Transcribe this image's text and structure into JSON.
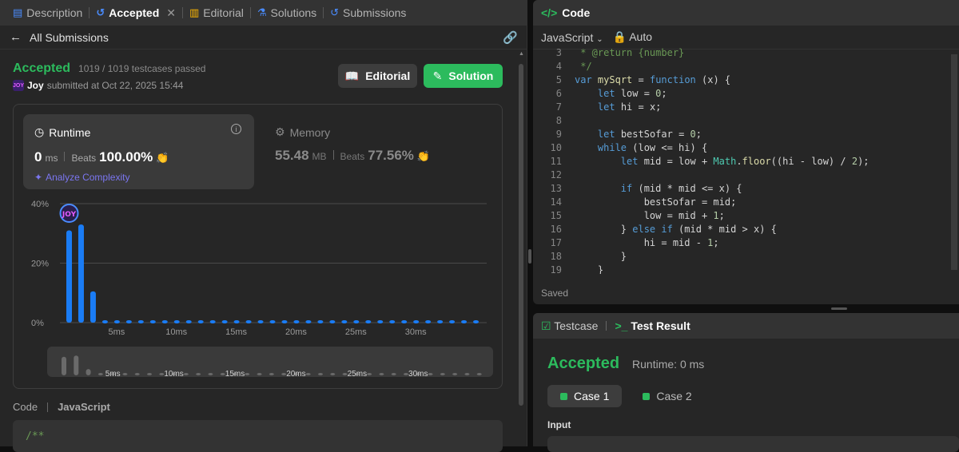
{
  "tabs": [
    {
      "label": "Description",
      "icon": "document-icon"
    },
    {
      "label": "Accepted",
      "icon": "history-icon"
    },
    {
      "label": "Editorial",
      "icon": "book-icon"
    },
    {
      "label": "Solutions",
      "icon": "flask-icon"
    },
    {
      "label": "Submissions",
      "icon": "history-icon"
    }
  ],
  "subheader": {
    "back_label": "All Submissions"
  },
  "result": {
    "status": "Accepted",
    "testcases": "1019 / 1019 testcases passed",
    "user": "Joy",
    "submitted_text": "submitted at Oct 22, 2025 15:44"
  },
  "buttons": {
    "editorial": "Editorial",
    "solution": "Solution"
  },
  "runtime": {
    "title": "Runtime",
    "value": "0",
    "unit": "ms",
    "beats_label": "Beats",
    "beats_value": "100.00%",
    "analyze": "Analyze Complexity"
  },
  "memory": {
    "title": "Memory",
    "value": "55.48",
    "unit": "MB",
    "beats_label": "Beats",
    "beats_value": "77.56%"
  },
  "chart_data": {
    "type": "bar",
    "y_ticks": [
      "40%",
      "20%",
      "0%"
    ],
    "ylim": [
      0,
      40
    ],
    "x_ticks": [
      "5ms",
      "10ms",
      "15ms",
      "20ms",
      "25ms",
      "30ms"
    ],
    "values": [
      31,
      33,
      10.5,
      0.8,
      0.8,
      0.8,
      0.8,
      0.8,
      0.8,
      0.8,
      0.8,
      0.8,
      0.8,
      0.8,
      0.8,
      0.8,
      0.8,
      0.8,
      0.8,
      0.8,
      0.8,
      0.8,
      0.8,
      0.8,
      0.8,
      0.8,
      0.8,
      0.8,
      0.8,
      0.8,
      0.8,
      0.8,
      0.8,
      0.8,
      0.8
    ],
    "highlight_index": 0,
    "avatar_text": "Joy",
    "bar_color": "#1a7cf5"
  },
  "code_section": {
    "label": "Code",
    "language": "JavaScript",
    "preview": "/**"
  },
  "editor": {
    "title": "Code",
    "language": "JavaScript",
    "mode": "Auto",
    "saved": "Saved",
    "lines": [
      {
        "no": "3",
        "html": "<span class='cm'> * @return {number}</span>"
      },
      {
        "no": "4",
        "html": "<span class='cm'> */</span>"
      },
      {
        "no": "5",
        "html": "<span class='kw'>var</span> <span class='fn'>mySqrt</span> = <span class='kw'>function</span> (x) {"
      },
      {
        "no": "6",
        "html": "    <span class='kw'>let</span> low = <span class='nu'>0</span>;"
      },
      {
        "no": "7",
        "html": "    <span class='kw'>let</span> hi = x;"
      },
      {
        "no": "8",
        "html": ""
      },
      {
        "no": "9",
        "html": "    <span class='kw'>let</span> bestSofar = <span class='nu'>0</span>;"
      },
      {
        "no": "10",
        "html": "    <span class='kw'>while</span> (low &lt;= hi) {"
      },
      {
        "no": "11",
        "html": "        <span class='kw'>let</span> mid = low + <span class='cl'>Math</span>.<span class='fn'>floor</span>((hi - low) / <span class='nu'>2</span>);"
      },
      {
        "no": "12",
        "html": ""
      },
      {
        "no": "13",
        "html": "        <span class='kw'>if</span> (mid * mid &lt;= x) {"
      },
      {
        "no": "14",
        "html": "            bestSofar = mid;"
      },
      {
        "no": "15",
        "html": "            low = mid + <span class='nu'>1</span>;"
      },
      {
        "no": "16",
        "html": "        } <span class='kw'>else if</span> (mid * mid &gt; x) {"
      },
      {
        "no": "17",
        "html": "            hi = mid - <span class='nu'>1</span>;"
      },
      {
        "no": "18",
        "html": "        }"
      },
      {
        "no": "19",
        "html": "    }"
      }
    ]
  },
  "testpanel": {
    "tab_testcase": "Testcase",
    "tab_result": "Test Result",
    "status": "Accepted",
    "runtime": "Runtime: 0 ms",
    "cases": [
      "Case 1",
      "Case 2"
    ],
    "input_label": "Input"
  }
}
